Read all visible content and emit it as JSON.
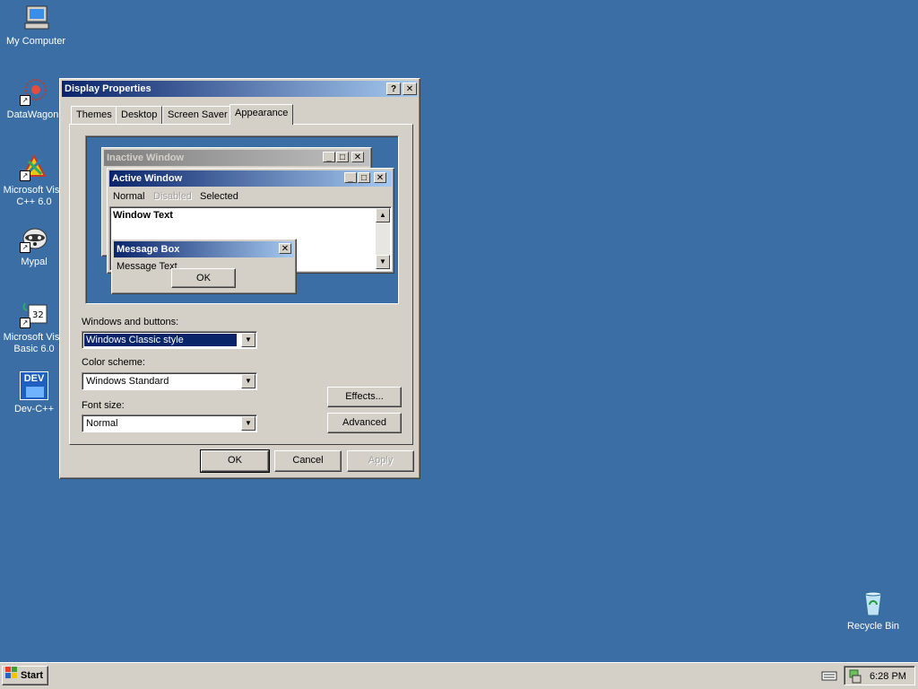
{
  "desktop": {
    "icons": [
      {
        "label": "My Computer"
      },
      {
        "label": "DataWagon."
      },
      {
        "label_line1": "Microsoft Visu",
        "label_line2": "C++ 6.0"
      },
      {
        "label": "Mypal"
      },
      {
        "label_line1": "Microsoft Visu",
        "label_line2": "Basic 6.0"
      },
      {
        "label": "Dev-C++",
        "badge": "DEV"
      },
      {
        "label": "Recycle Bin"
      }
    ]
  },
  "dialog": {
    "title": "Display Properties",
    "help_glyph": "?",
    "close_glyph": "✕",
    "tabs": [
      "Themes",
      "Desktop",
      "Screen Saver",
      "Appearance"
    ],
    "selected_tab": "Appearance",
    "preview": {
      "inactive_title": "Inactive Window",
      "active_title": "Active Window",
      "menu_normal": "Normal",
      "menu_disabled": "Disabled",
      "menu_selected": "Selected",
      "window_text": "Window Text",
      "msgbox_title": "Message Box",
      "msgbox_text": "Message Text",
      "msgbox_ok": "OK"
    },
    "windows_buttons_label": "Windows and buttons:",
    "windows_buttons_value": "Windows Classic style",
    "color_scheme_label": "Color scheme:",
    "color_scheme_value": "Windows Standard",
    "font_size_label": "Font size:",
    "font_size_value": "Normal",
    "effects_button": "Effects...",
    "advanced_button": "Advanced",
    "ok_button": "OK",
    "cancel_button": "Cancel",
    "apply_button": "Apply"
  },
  "taskbar": {
    "start_label": "Start",
    "clock": "6:28 PM"
  },
  "colors": {
    "desktop": "#3a6ea5",
    "face": "#d4d0c8",
    "active_title": "#0a246a",
    "inactive_title": "#808080"
  }
}
